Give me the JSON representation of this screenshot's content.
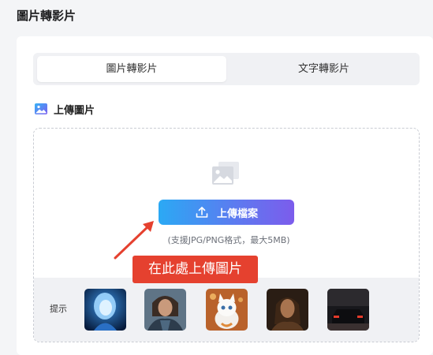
{
  "page": {
    "title": "圖片轉影片"
  },
  "tabs": [
    {
      "label": "圖片轉影片",
      "active": true
    },
    {
      "label": "文字轉影片",
      "active": false
    }
  ],
  "upload": {
    "section_label": "上傳圖片",
    "button_label": "上傳檔案",
    "hint": "(支援JPG/PNG格式，最大5MB)"
  },
  "samples": {
    "label": "提示",
    "items": [
      {
        "icon": "blue-glow-woman-thumbnail"
      },
      {
        "icon": "armored-woman-thumbnail"
      },
      {
        "icon": "white-kitten-thumbnail"
      },
      {
        "icon": "long-hair-man-thumbnail"
      },
      {
        "icon": "dark-car-thumbnail"
      }
    ]
  },
  "annotation": {
    "callout": "在此處上傳圖片"
  },
  "colors": {
    "accent_start": "#2ba9f4",
    "accent_end": "#7c5cec",
    "callout": "#e5412f",
    "arrow": "#e5412f"
  }
}
